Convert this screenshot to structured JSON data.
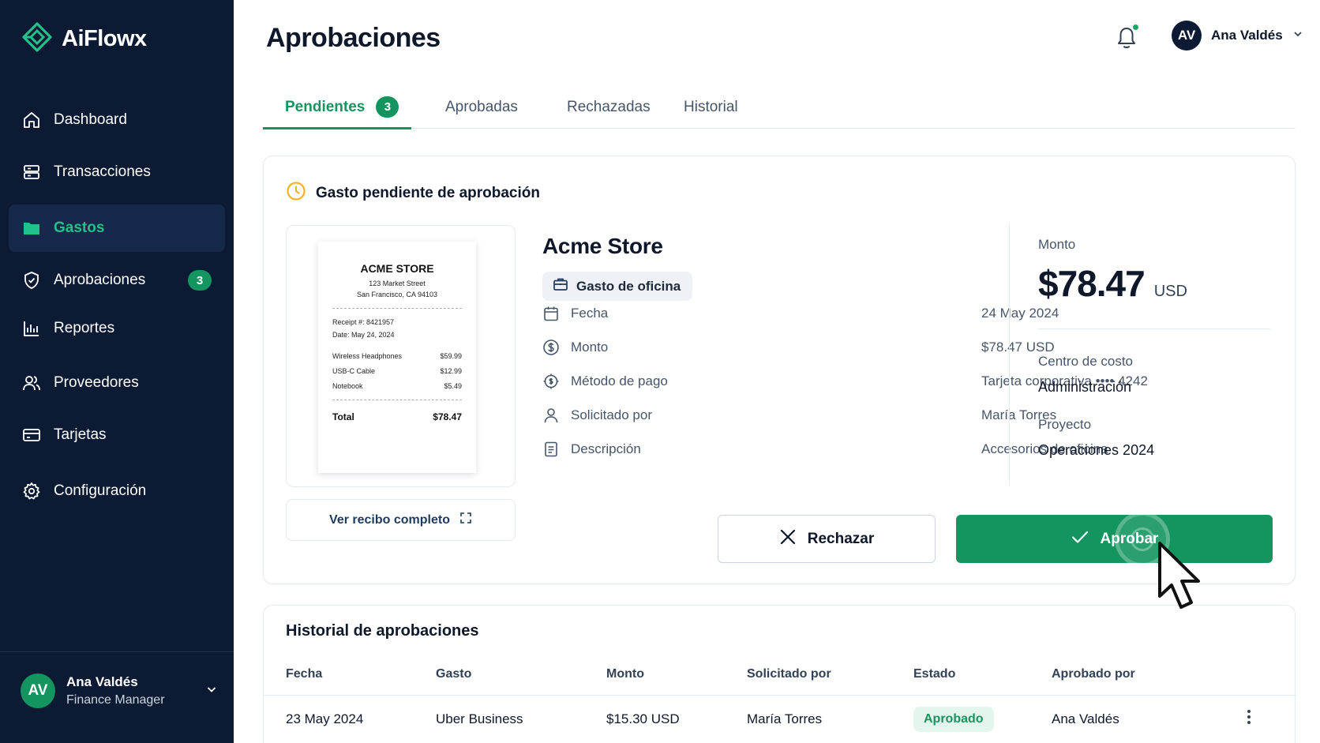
{
  "app": {
    "name": "AiFlowx"
  },
  "sidebar": {
    "items": [
      {
        "label": "Dashboard",
        "icon": "home-icon"
      },
      {
        "label": "Transacciones",
        "icon": "transactions-icon"
      },
      {
        "label": "Gastos",
        "icon": "folder-icon",
        "active": true
      },
      {
        "label": "Aprobaciones",
        "icon": "shield-check-icon",
        "badge": "3"
      },
      {
        "label": "Reportes",
        "icon": "bar-chart-icon"
      },
      {
        "label": "Proveedores",
        "icon": "users-icon"
      },
      {
        "label": "Tarjetas",
        "icon": "credit-card-icon"
      },
      {
        "label": "Configuración",
        "icon": "gear-icon"
      }
    ],
    "user": {
      "initials": "AV",
      "name": "Ana Valdés",
      "role": "Finance Manager"
    }
  },
  "header": {
    "title": "Aprobaciones",
    "user": {
      "initials": "AV",
      "name": "Ana Valdés"
    },
    "notification_dot_color": "#14a86b"
  },
  "tabs": [
    {
      "label": "Pendientes",
      "badge": "3",
      "active": true
    },
    {
      "label": "Aprobadas"
    },
    {
      "label": "Rechazadas"
    },
    {
      "label": "Historial"
    }
  ],
  "pending": {
    "heading": "Gasto pendiente de aprobación",
    "receipt": {
      "store": "ACME STORE",
      "address1": "123 Market Street",
      "address2": "San Francisco, CA 94103",
      "receipt_no": "Receipt #: 8421957",
      "date": "Date: May 24, 2024",
      "items": [
        {
          "name": "Wireless Headphones",
          "price": "$59.99"
        },
        {
          "name": "USB-C Cable",
          "price": "$12.99"
        },
        {
          "name": "Notebook",
          "price": "$5.49"
        }
      ],
      "total_label": "Total",
      "total": "$78.47",
      "view_full_label": "Ver recibo completo"
    },
    "merchant": "Acme Store",
    "category": "Gasto de oficina",
    "details": [
      {
        "label": "Fecha",
        "value": "24 May 2024",
        "icon": "calendar-icon"
      },
      {
        "label": "Monto",
        "value": "$78.47 USD",
        "icon": "dollar-circle-icon"
      },
      {
        "label": "Método de pago",
        "value": "Tarjeta corporativa •••• 4242",
        "icon": "payment-icon"
      },
      {
        "label": "Solicitado por",
        "value": "María Torres",
        "icon": "user-icon"
      },
      {
        "label": "Descripción",
        "value": "Accesorios de oficina",
        "icon": "document-icon"
      }
    ],
    "amount_label": "Monto",
    "amount": "$78.47",
    "currency": "USD",
    "cost_center_label": "Centro de costo",
    "cost_center": "Administración",
    "project_label": "Proyecto",
    "project": "Operaciones 2024",
    "reject_label": "Rechazar",
    "approve_label": "Aprobar"
  },
  "history": {
    "title": "Historial de aprobaciones",
    "columns": [
      "Fecha",
      "Gasto",
      "Monto",
      "Solicitado por",
      "Estado",
      "Aprobado por"
    ],
    "rows": [
      {
        "fecha": "23 May 2024",
        "gasto": "Uber Business",
        "monto": "$15.30 USD",
        "solicitado": "María Torres",
        "estado": "Aprobado",
        "aprobado": "Ana Valdés"
      }
    ]
  },
  "colors": {
    "accent": "#14955f",
    "sidebar": "#0c1b33",
    "warning": "#f5b324"
  }
}
